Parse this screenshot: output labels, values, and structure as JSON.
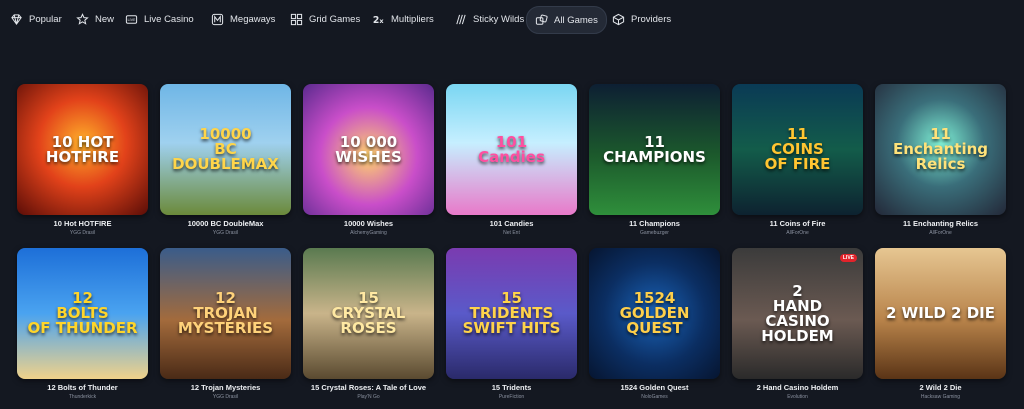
{
  "nav": [
    {
      "key": "popular",
      "label": "Popular",
      "icon": "diamond-icon"
    },
    {
      "key": "new",
      "label": "New",
      "icon": "star-icon"
    },
    {
      "key": "live-casino",
      "label": "Live Casino",
      "icon": "live-icon"
    },
    {
      "key": "megaways",
      "label": "Megaways",
      "icon": "megaways-icon"
    },
    {
      "key": "grid-games",
      "label": "Grid Games",
      "icon": "grid-icon"
    },
    {
      "key": "multipliers",
      "label": "Multipliers",
      "icon": "multiplier-icon"
    },
    {
      "key": "sticky-wilds",
      "label": "Sticky Wilds",
      "icon": "sticky-icon"
    },
    {
      "key": "all-games",
      "label": "All Games",
      "icon": "dice-icon",
      "active": true
    },
    {
      "key": "providers",
      "label": "Providers",
      "icon": "providers-icon"
    }
  ],
  "games": [
    {
      "title": "10 Hot HOTFIRE",
      "provider": "YGG Drasil",
      "art": "10 HOT\nHOTFIRE",
      "bg": "radial-gradient(circle at 50% 45%, #ffb02a 0%, #e2421a 45%, #5a0d07 100%)",
      "fg": "#ffffff"
    },
    {
      "title": "10000 BC DoubleMax",
      "provider": "YGG Drasil",
      "art": "10000\nBC\nDOUBLEMAX",
      "bg": "linear-gradient(180deg, #6fb6e6 0%, #9fd1ef 45%, #6b8a3a 100%)",
      "fg": "#ffd54a"
    },
    {
      "title": "10000 Wishes",
      "provider": "AlchemyGaming",
      "art": "10 000\nWISHES",
      "bg": "radial-gradient(circle at 50% 55%, #ffd36b 0%, #c94ec9 50%, #5b2a8e 100%)",
      "fg": "#ffffff"
    },
    {
      "title": "101 Candies",
      "provider": "Net Ent",
      "art": "101\nCandies",
      "bg": "linear-gradient(180deg, #7ad6f2 0%, #c6efff 45%, #e879c9 100%)",
      "fg": "#ff4fa0"
    },
    {
      "title": "11 Champions",
      "provider": "Gamebuzger",
      "art": "11\nCHAMPIONS",
      "bg": "linear-gradient(180deg, #0d1f33 0%, #1c5a2c 55%, #2f8f3b 100%)",
      "fg": "#ffffff"
    },
    {
      "title": "11 Coins of Fire",
      "provider": "AllForOne",
      "art": "11\nCOINS\nOF FIRE",
      "bg": "linear-gradient(180deg, #0a3a55 0%, #135c4a 50%, #0d2230 100%)",
      "fg": "#ffc531"
    },
    {
      "title": "11 Enchanting Relics",
      "provider": "AllForOne",
      "art": "11\nEnchanting\nRelics",
      "bg": "radial-gradient(circle at 50% 45%, #7ff0d5 0%, #3a6e7a 45%, #232838 100%)",
      "fg": "#ffe27a"
    },
    {
      "title": "12 Bolts of Thunder",
      "provider": "Thunderkick",
      "art": "12\nBOLTS\nOF THUNDER",
      "bg": "linear-gradient(180deg, #1d6fd8 0%, #4aa3f0 50%, #f0d28a 100%)",
      "fg": "#ffd52a"
    },
    {
      "title": "12 Trojan Mysteries",
      "provider": "YGG Drasil",
      "art": "12\nTROJAN\nMYSTERIES",
      "bg": "linear-gradient(180deg, #3a5c8a 0%, #a36b3c 55%, #4a2a16 100%)",
      "fg": "#ffd27a"
    },
    {
      "title": "15 Crystal Roses: A Tale of Love",
      "provider": "Play'N Go",
      "art": "15\nCRYSTAL ROSES",
      "bg": "linear-gradient(180deg, #5a7a50 0%, #c9b48a 50%, #5a4a30 100%)",
      "fg": "#ffe9a3"
    },
    {
      "title": "15 Tridents",
      "provider": "PureFiction",
      "art": "15\nTRIDENTS\nSWIFT HITS",
      "bg": "linear-gradient(180deg, #7a3bb0 0%, #5a5ac9 50%, #2a2a6a 100%)",
      "fg": "#ffd34a"
    },
    {
      "title": "1524 Golden Quest",
      "provider": "NoloGames",
      "art": "1524\nGOLDEN\nQUEST",
      "bg": "radial-gradient(circle at 50% 50%, #1a63b8 0%, #0b2e62 55%, #061530 100%)",
      "fg": "#ffcf4a"
    },
    {
      "title": "2 Hand Casino Holdem",
      "provider": "Evolution",
      "art": "2\nHAND\nCASINO HOLDEM",
      "bg": "linear-gradient(180deg, #3b3b3b 0%, #6b5a52 55%, #2a2a2a 100%)",
      "fg": "#ffffff",
      "live": "LIVE"
    },
    {
      "title": "2 Wild 2 Die",
      "provider": "Hacksaw Gaming",
      "art": "2 WILD 2 DIE",
      "bg": "linear-gradient(180deg, #e6c692 0%, #b8834a 55%, #5a3416 100%)",
      "fg": "#ffffff"
    }
  ]
}
